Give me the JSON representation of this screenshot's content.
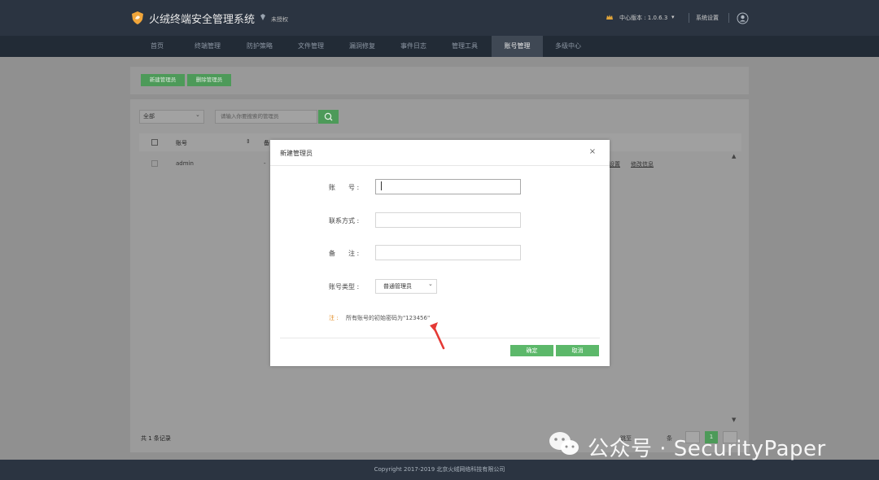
{
  "header": {
    "app_title": "火绒终端安全管理系统",
    "license_status": "未授权",
    "center_version": "中心版本 : 1.0.6.3",
    "system_settings": "系统设置"
  },
  "nav": {
    "items": [
      {
        "label": "首页"
      },
      {
        "label": "终端管理"
      },
      {
        "label": "防护策略"
      },
      {
        "label": "文件管理"
      },
      {
        "label": "漏洞修复"
      },
      {
        "label": "事件日志"
      },
      {
        "label": "管理工具"
      },
      {
        "label": "账号管理",
        "active": true
      },
      {
        "label": "多级中心"
      }
    ]
  },
  "toolbar": {
    "new_admin": "新建管理员",
    "delete_admin": "删除管理员"
  },
  "list": {
    "filter_value": "全部",
    "search_placeholder": "请输入你要搜索的管理员",
    "col_account": "账号",
    "col_more": "备",
    "rows": [
      {
        "account": "admin",
        "dash": "-",
        "action_a": "设置",
        "action_b": "修改信息"
      }
    ],
    "total": "共 1 条记录",
    "pager_text": "跳至",
    "pager_unit": "条",
    "current_page": "1"
  },
  "footer": {
    "copyright": "Copyright 2017-2019 北京火绒网络科技有限公司"
  },
  "modal": {
    "title": "新建管理员",
    "close": "×",
    "account_label": "账　　号 :",
    "account_value": "",
    "contact_label": "联系方式 :",
    "contact_value": "",
    "remark_label": "备　　注 :",
    "remark_value": "",
    "type_label": "账号类型 :",
    "type_value": "普通管理员",
    "note_label": "注 :",
    "note_text": "所有账号的初始密码为\"123456\"",
    "ok": "确定",
    "cancel": "取消"
  },
  "watermark": {
    "text": "公众号 · SecurityPaper"
  },
  "colors": {
    "header_bg": "#2b3441",
    "nav_bg": "#222b36",
    "accent_green": "#5cb86a",
    "note_orange": "#e28a1f",
    "arrow_red": "#e53935"
  },
  "icons": {
    "logo": "shield-logo-icon",
    "license": "diamond-icon",
    "version": "crown-icon",
    "user": "user-icon",
    "search": "search-icon",
    "watermark": "wechat-icon"
  }
}
